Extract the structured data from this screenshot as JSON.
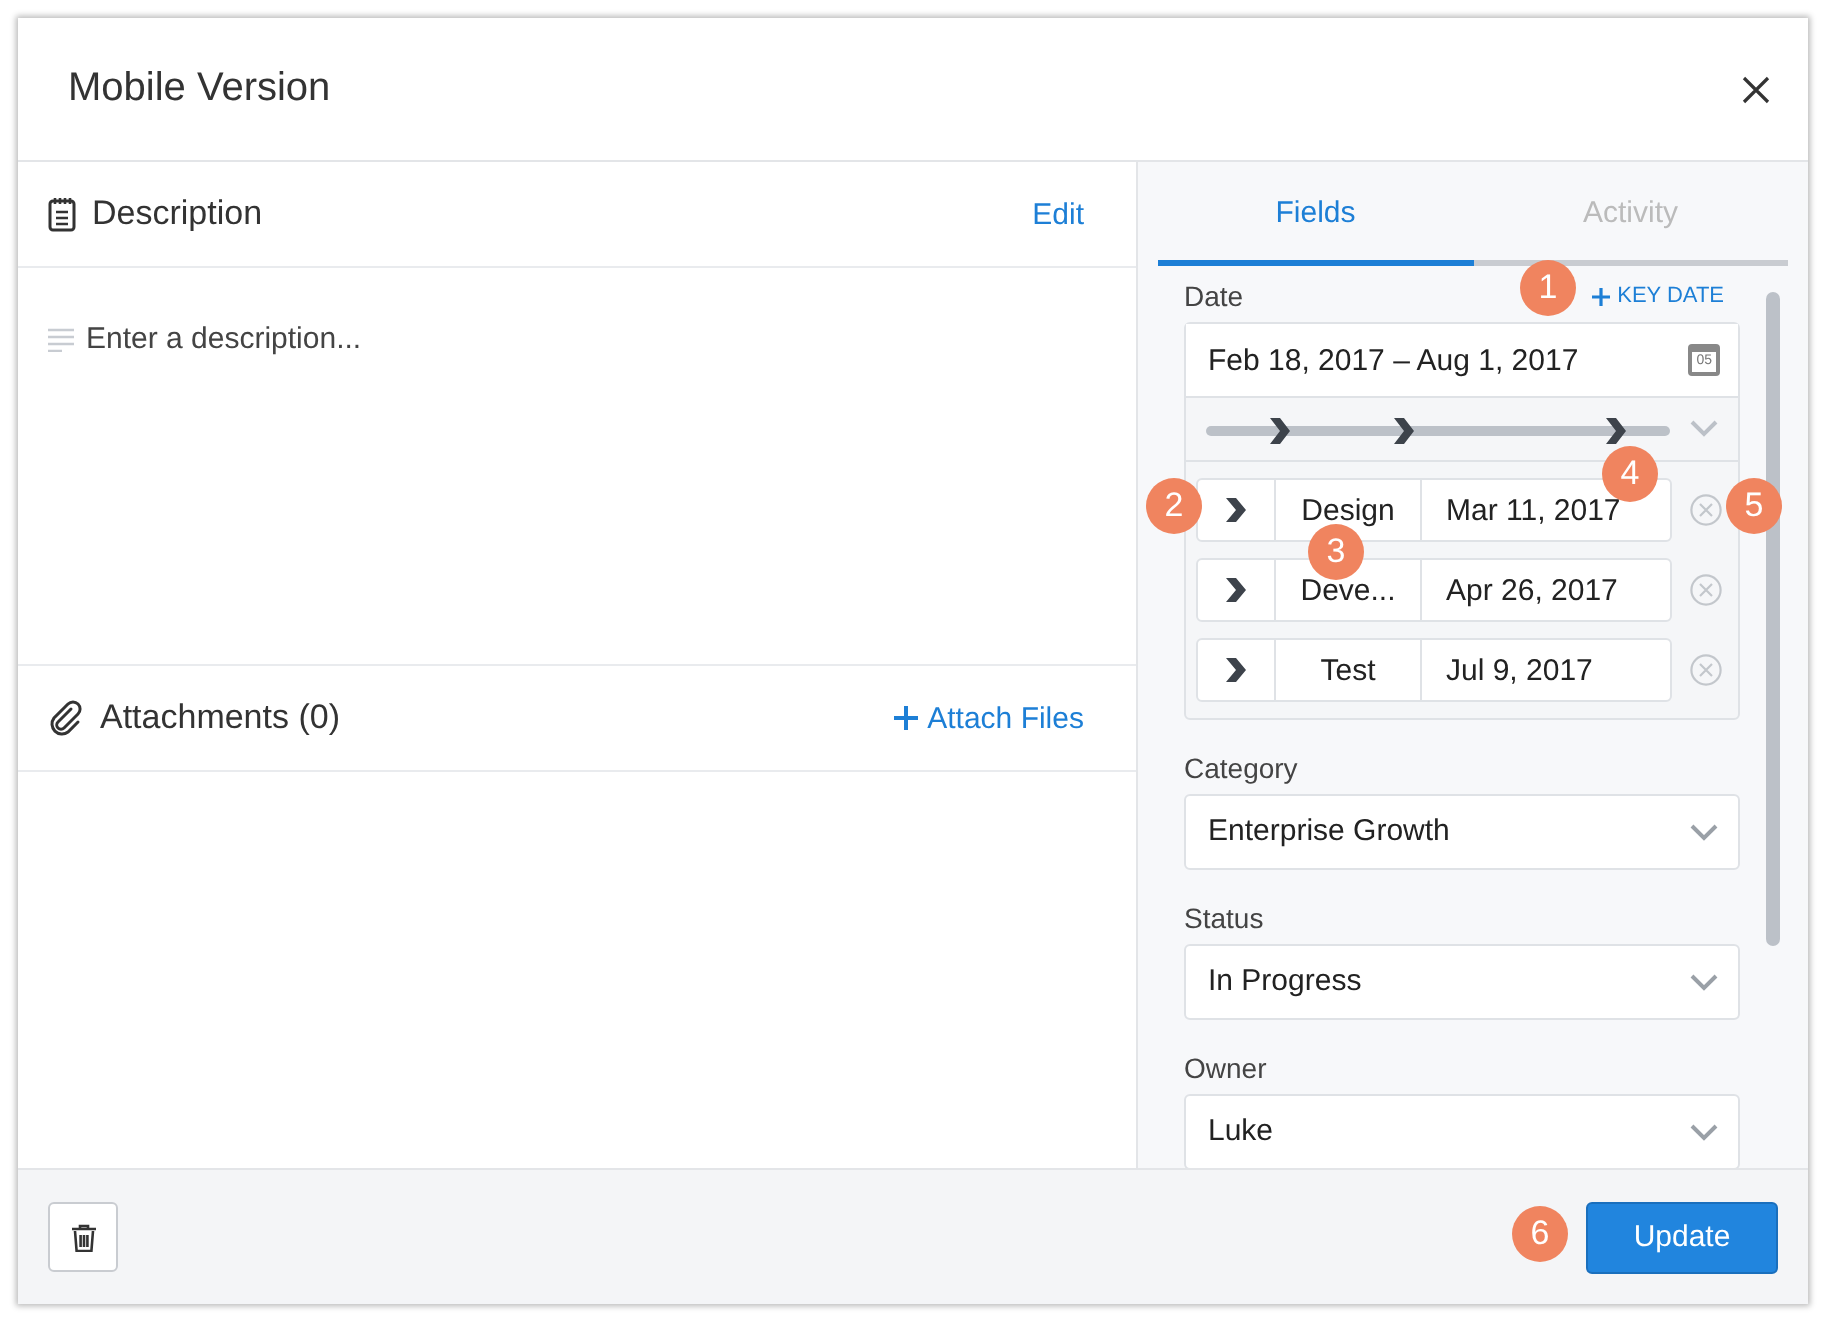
{
  "dialog": {
    "title": "Mobile Version"
  },
  "description": {
    "title": "Description",
    "edit_link": "Edit",
    "placeholder": "Enter a description..."
  },
  "attachments": {
    "title": "Attachments (0)",
    "attach_link": "Attach Files"
  },
  "tabs": [
    {
      "label": "Fields",
      "selected": true
    },
    {
      "label": "Activity",
      "selected": false
    }
  ],
  "date_field": {
    "label": "Date",
    "add_key_date": "KEY DATE",
    "range": "Feb 18, 2017 – Aug 1, 2017",
    "calendar_badge": "05",
    "phases": [
      {
        "name": "Design",
        "date": "Mar 11, 2017"
      },
      {
        "name": "Deve...",
        "date": "Apr 26, 2017"
      },
      {
        "name": "Test",
        "date": "Jul 9, 2017"
      }
    ]
  },
  "selects": [
    {
      "label": "Category",
      "value": "Enterprise Growth"
    },
    {
      "label": "Status",
      "value": "In Progress"
    },
    {
      "label": "Owner",
      "value": "Luke"
    }
  ],
  "update_button": "Update",
  "callouts": [
    {
      "label": "1"
    },
    {
      "label": "2"
    },
    {
      "label": "3"
    },
    {
      "label": "4"
    },
    {
      "label": "5"
    },
    {
      "label": "6"
    }
  ]
}
